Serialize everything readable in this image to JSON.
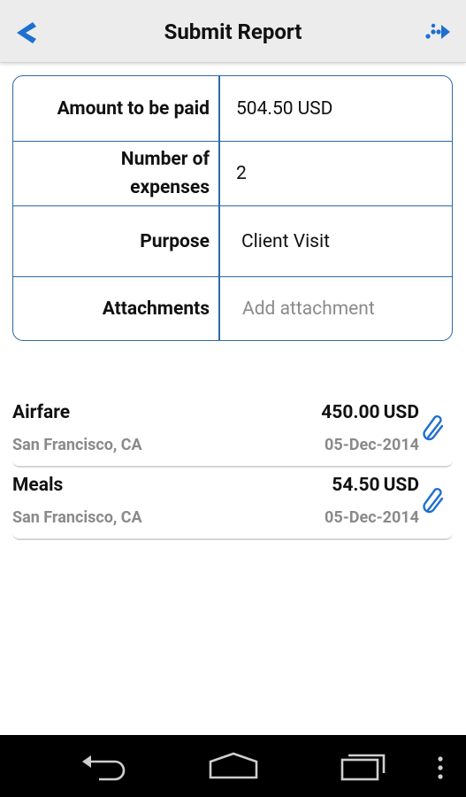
{
  "header": {
    "title": "Submit Report"
  },
  "summary": {
    "amount_label": "Amount to be paid",
    "amount_value": "504.50",
    "amount_currency": "USD",
    "count_label_line1": "Number of",
    "count_label_line2": "expenses",
    "count_value": "2",
    "purpose_label": "Purpose",
    "purpose_value": "Client Visit",
    "attachments_label": "Attachments",
    "attachments_placeholder": "Add attachment"
  },
  "expenses": [
    {
      "name": "Airfare",
      "amount": "450.00",
      "currency": "USD",
      "location": "San Francisco, CA",
      "date": "05-Dec-2014"
    },
    {
      "name": "Meals",
      "amount": "54.50",
      "currency": "USD",
      "location": "San Francisco, CA",
      "date": "05-Dec-2014"
    }
  ],
  "icons": {
    "back": "back-arrow-icon",
    "submit": "submit-dots-arrow-icon",
    "attachment": "paperclip-icon",
    "nav_back": "nav-back-icon",
    "nav_home": "nav-home-icon",
    "nav_recents": "nav-recents-icon",
    "nav_menu": "overflow-menu-icon"
  },
  "colors": {
    "accent": "#1e6fd0",
    "border": "#2b6aa6",
    "muted_text": "#8a8a8a"
  }
}
